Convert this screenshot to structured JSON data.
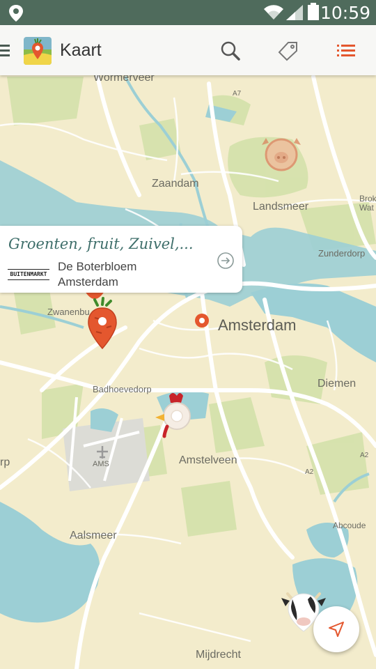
{
  "status_bar": {
    "time": "10:59"
  },
  "app_bar": {
    "title": "Kaart"
  },
  "map": {
    "labels": {
      "wormerveer": "Wormerveer",
      "a7": "A7",
      "zaandam": "Zaandam",
      "landsmeer": "Landsmeer",
      "brok": "Brok",
      "wat": "Wat",
      "zunderdorp": "Zunderdorp",
      "zwanenburg": "Zwanenbu",
      "amsterdam": "Amsterdam",
      "badhoevedorp": "Badhoevedorp",
      "diemen": "Diemen",
      "rp": "rp",
      "ams": "AMS",
      "amstelveen": "Amstelveen",
      "a2_north": "A2",
      "a2_south": "A2",
      "abcoude": "Abcoude",
      "aalsmeer": "Aalsmeer",
      "mijdrecht": "Mijdrecht"
    },
    "markers": [
      {
        "name": "pig-marker",
        "category": "pig"
      },
      {
        "name": "carrot-marker",
        "category": "vegetables"
      },
      {
        "name": "location-dot",
        "category": "selected"
      },
      {
        "name": "chicken-marker",
        "category": "chicken"
      },
      {
        "name": "cow-marker",
        "category": "cow"
      }
    ]
  },
  "popup": {
    "category": "Groenten, fruit, Zuivel,...",
    "brand_logo_text": "BUITENMARKT",
    "name": "De Boterbloem",
    "city": "Amsterdam"
  },
  "colors": {
    "status_bar": "#4f6b5c",
    "accent": "#e4572e",
    "map_land": "#f3eccc",
    "map_water": "#9ccfd5",
    "map_green": "#cfe0a6",
    "popup_heading": "#3e6e6a"
  }
}
